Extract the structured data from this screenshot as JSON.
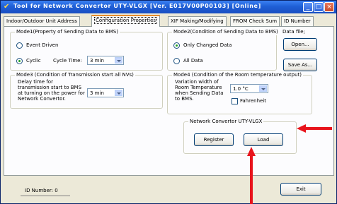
{
  "window": {
    "title": "Tool for Network Convertor UTY-VLGX [Ver. E017V00P00103] [Online]",
    "controls": {
      "minimize": "_",
      "maximize": "□",
      "close": "×"
    }
  },
  "tabs": [
    {
      "label": "Indoor/Outdoor Unit Address",
      "active": false
    },
    {
      "label": "Configuration Properties",
      "active": true
    },
    {
      "label": "XIF Making/Modifying",
      "active": false
    },
    {
      "label": "FROM Check Sum",
      "active": false
    },
    {
      "label": "ID Number",
      "active": false
    }
  ],
  "mode1": {
    "title": "Mode1(Property of Sending Data to BMS)",
    "event_driven": "Event Driven",
    "cyclic": "Cyclic",
    "cycle_time_label": "Cycle Time:",
    "cycle_time_value": "3 min",
    "selected": "cyclic"
  },
  "mode2": {
    "title": "Mode2(Condition of Sending Data to BMS)",
    "only_changed": "Only Changed Data",
    "all_data": "All Data",
    "selected": "only_changed"
  },
  "data_file": {
    "title": "Data file;",
    "open_label": "Open...",
    "save_label": "Save As..."
  },
  "mode3": {
    "title": "Mode3 (Condition of Transmission start all NVs)",
    "description": "Delay time for transmission start to BMS at turning on the power for Network Convertor.",
    "delay_value": "3 min"
  },
  "mode4": {
    "title": "Mode4 (Condition of the Room temperature output)",
    "description": "Variation width of Room Temperature when Sending Data to BMS.",
    "variation_value": "1.0 °C",
    "fahrenheit_label": "Fahrenheit",
    "fahrenheit_checked": false
  },
  "network": {
    "title": "Network Convertor UTY-VLGX",
    "register_label": "Register",
    "load_label": "Load"
  },
  "footer": {
    "id_number": "ID Number:  0",
    "exit_label": "Exit"
  },
  "colors": {
    "annotation_arrow": "#e8141c",
    "titlebar": "#1f5fd6",
    "active_tab_accent": "#e68b2c"
  }
}
